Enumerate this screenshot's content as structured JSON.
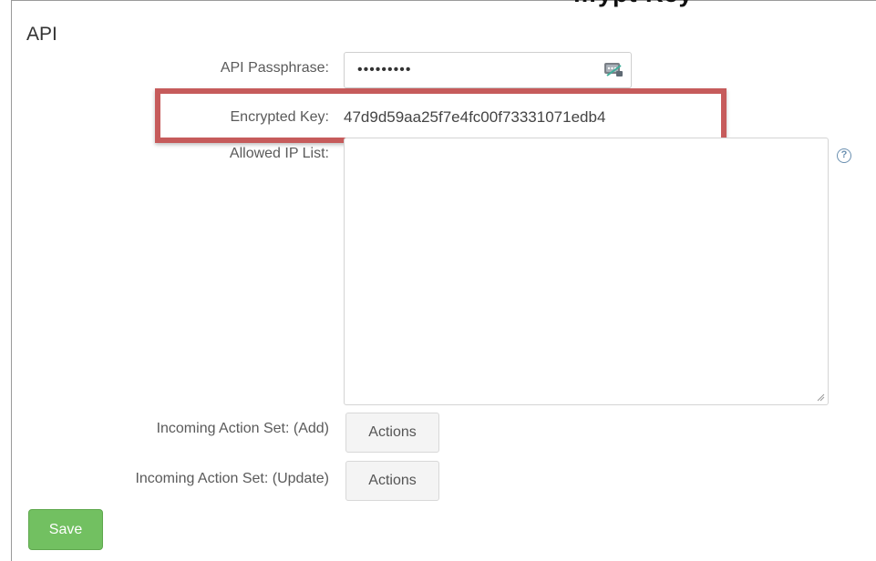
{
  "section": {
    "title": "API"
  },
  "clipped_header": "…ypt Key",
  "fields": {
    "passphrase": {
      "label": "API Passphrase:",
      "value": "•••••••••"
    },
    "encrypted_key": {
      "label": "Encrypted Key:",
      "value": "47d9d59aa25f7e4fc00f73331071edb4"
    },
    "allowed_ip": {
      "label": "Allowed IP List:",
      "value": ""
    },
    "action_add": {
      "label": "Incoming Action Set: (Add)",
      "button": "Actions"
    },
    "action_update": {
      "label": "Incoming Action Set: (Update)",
      "button": "Actions"
    }
  },
  "help_glyph": "?",
  "save_label": "Save",
  "colors": {
    "highlight_border": "#c65b5b",
    "save_green": "#72c061",
    "help_blue": "#6a8fb0"
  }
}
